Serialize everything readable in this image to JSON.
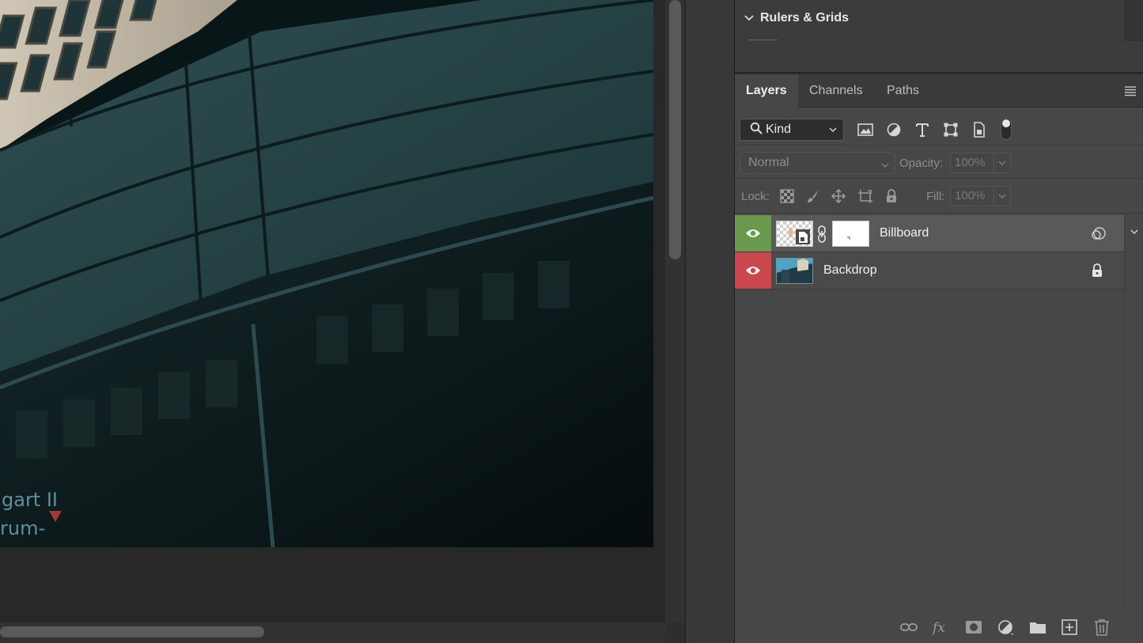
{
  "rulers_panel": {
    "title": "Rulers & Grids"
  },
  "layers_panel": {
    "tabs": [
      {
        "label": "Layers",
        "active": true
      },
      {
        "label": "Channels",
        "active": false
      },
      {
        "label": "Paths",
        "active": false
      }
    ],
    "filter": {
      "kind_label": "Kind",
      "icons": [
        "image-filter-icon",
        "adjustment-filter-icon",
        "type-filter-icon",
        "shape-filter-icon",
        "smart-object-filter-icon"
      ]
    },
    "blend_mode": "Normal",
    "opacity_label": "Opacity:",
    "opacity_value": "100%",
    "lock_label": "Lock:",
    "fill_label": "Fill:",
    "fill_value": "100%",
    "layers": [
      {
        "name": "Billboard",
        "visible": true,
        "eye_color": "#6a994e",
        "has_mask": true,
        "smart_object": true
      },
      {
        "name": "Backdrop",
        "visible": true,
        "eye_color": "#c9474d",
        "locked": true
      }
    ],
    "footer_icons": [
      "link-layers-icon",
      "fx-icon",
      "add-mask-icon",
      "adjustment-layer-icon",
      "new-group-icon",
      "new-layer-icon",
      "trash-icon"
    ]
  },
  "canvas": {
    "sign_text_1": "gart II",
    "sign_text_2": "rum-"
  }
}
